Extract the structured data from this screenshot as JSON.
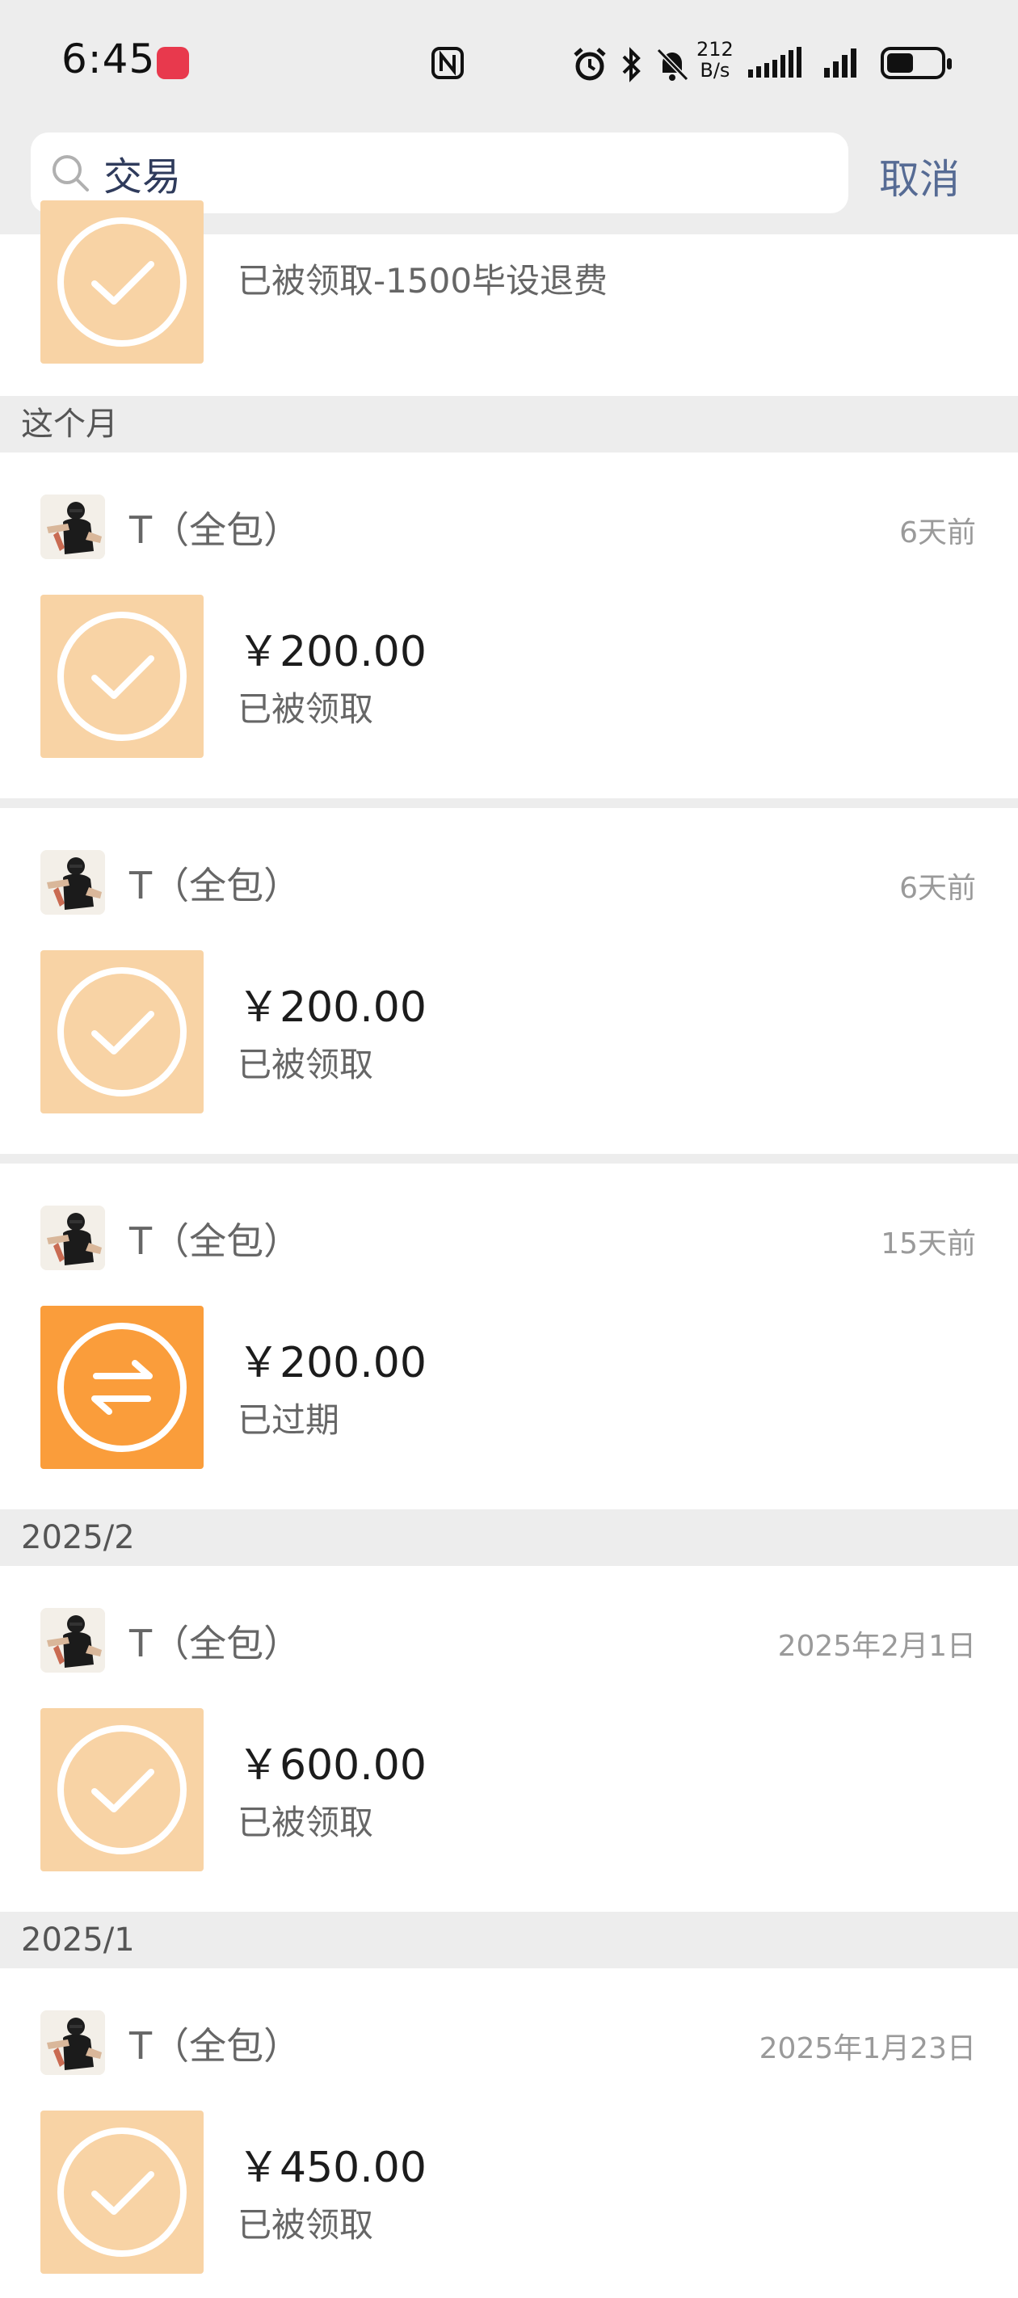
{
  "status_bar": {
    "time": "6:45",
    "net_speed_top": "212",
    "net_speed_bottom": "B/s",
    "battery_level": 0.5,
    "icons": [
      "app-badge-icon",
      "nfc-icon",
      "alarm-icon",
      "bluetooth-icon",
      "mute-bell-icon",
      "signal-icon",
      "signal-icon",
      "battery-icon"
    ]
  },
  "search": {
    "value": "交易",
    "cancel_label": "取消"
  },
  "partial_item": {
    "status": "已被领取-1500毕设退费"
  },
  "sections": [
    {
      "header": "这个月",
      "items": [
        {
          "sender": "T（全包）",
          "time": "6天前",
          "amount": "￥200.00",
          "status": "已被领取",
          "state": "claimed"
        },
        {
          "sender": "T（全包）",
          "time": "6天前",
          "amount": "￥200.00",
          "status": "已被领取",
          "state": "claimed"
        },
        {
          "sender": "T（全包）",
          "time": "15天前",
          "amount": "￥200.00",
          "status": "已过期",
          "state": "expired"
        }
      ]
    },
    {
      "header": "2025/2",
      "items": [
        {
          "sender": "T（全包）",
          "time": "2025年2月1日",
          "amount": "￥600.00",
          "status": "已被领取",
          "state": "claimed"
        }
      ]
    },
    {
      "header": "2025/1",
      "items": [
        {
          "sender": "T（全包）",
          "time": "2025年1月23日",
          "amount": "￥450.00",
          "status": "已被领取",
          "state": "claimed"
        }
      ]
    }
  ],
  "colors": {
    "claimed_tile": "#f8d3a5",
    "expired_tile": "#fa9d3b",
    "cancel_text": "#566b94",
    "section_bg": "#ededed"
  }
}
